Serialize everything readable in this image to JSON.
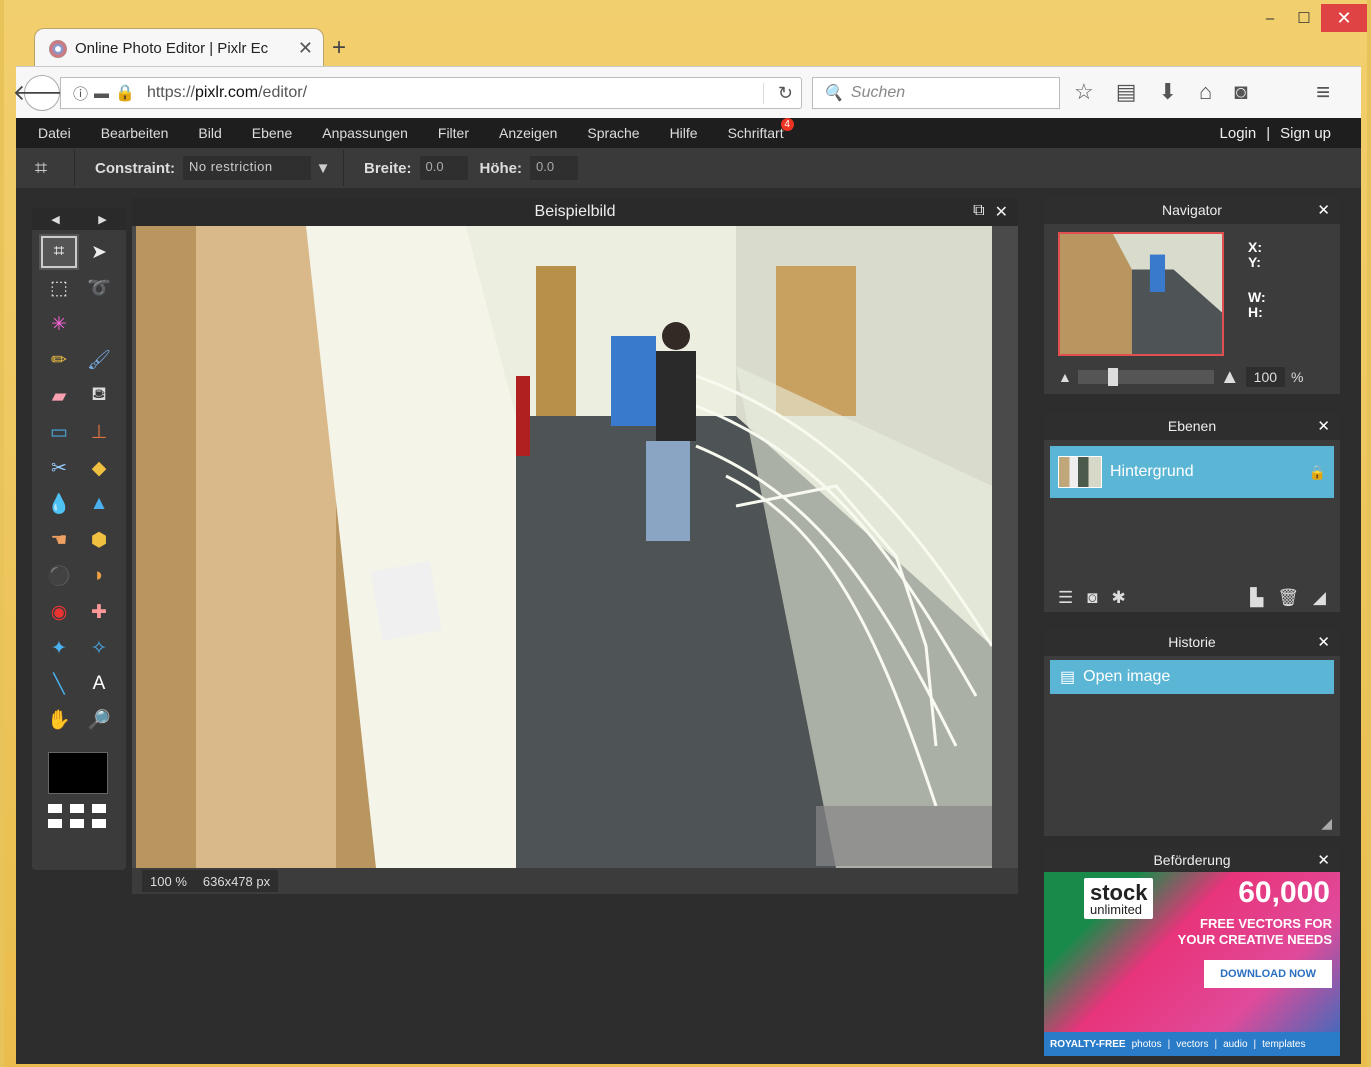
{
  "window": {
    "min": "–",
    "max": "☐",
    "close": "✕"
  },
  "tab": {
    "title": "Online Photo Editor | Pixlr Ec",
    "close": "✕",
    "new_tab": "+"
  },
  "navbar": {
    "back": "🡐",
    "info": "ⓘ",
    "url_prefix": "https://",
    "url_domain": "pixlr.com",
    "url_path": "/editor/",
    "reload": "↻",
    "search_placeholder": "Suchen",
    "search_icon": "🔍"
  },
  "toolbar_icons": [
    "☆",
    "▤",
    "⬇",
    "⌂",
    "◙"
  ],
  "menu_icon": "≡",
  "app": {
    "menu": [
      "Datei",
      "Bearbeiten",
      "Bild",
      "Ebene",
      "Anpassungen",
      "Filter",
      "Anzeigen",
      "Sprache",
      "Hilfe",
      "Schriftart"
    ],
    "font_badge": "4",
    "login": "Login",
    "separator": "|",
    "signup": "Sign up",
    "options": {
      "constraint_label": "Constraint:",
      "constraint_value": "No restriction",
      "width_label": "Breite:",
      "width_value": "0.0",
      "height_label": "Höhe:",
      "height_value": "0.0"
    },
    "toolbox": {
      "left_arrow": "◀",
      "right_arrow": "▶",
      "tools": [
        {
          "icon": "crop-icon",
          "glyph": "⌗"
        },
        {
          "icon": "move-icon",
          "glyph": "➤"
        },
        {
          "icon": "marquee-icon",
          "glyph": "⬚"
        },
        {
          "icon": "lasso-icon",
          "glyph": "➰"
        },
        {
          "icon": "wand-icon",
          "glyph": "✳"
        },
        {
          "icon": "blank",
          "glyph": ""
        },
        {
          "icon": "pencil-icon",
          "glyph": "✏"
        },
        {
          "icon": "brush-icon",
          "glyph": "🖌"
        },
        {
          "icon": "eraser-icon",
          "glyph": "▰"
        },
        {
          "icon": "bucket-icon",
          "glyph": "⛾"
        },
        {
          "icon": "gradient-icon",
          "glyph": "▭"
        },
        {
          "icon": "stamp-icon",
          "glyph": "⊥"
        },
        {
          "icon": "color-replace-icon",
          "glyph": "✂"
        },
        {
          "icon": "drawing-icon",
          "glyph": "◆"
        },
        {
          "icon": "blur-icon",
          "glyph": "💧"
        },
        {
          "icon": "sharpen-icon",
          "glyph": "▲"
        },
        {
          "icon": "smudge-icon",
          "glyph": "☚"
        },
        {
          "icon": "sponge-icon",
          "glyph": "⬢"
        },
        {
          "icon": "burn-icon",
          "glyph": "⚫"
        },
        {
          "icon": "dodge-icon",
          "glyph": "◗"
        },
        {
          "icon": "redeye-icon",
          "glyph": "◉"
        },
        {
          "icon": "spot-heal-icon",
          "glyph": "✚"
        },
        {
          "icon": "bloat-icon",
          "glyph": "✦"
        },
        {
          "icon": "pinch-icon",
          "glyph": "✧"
        },
        {
          "icon": "color-picker-icon",
          "glyph": "╲"
        },
        {
          "icon": "type-icon",
          "glyph": "A"
        },
        {
          "icon": "hand-icon",
          "glyph": "✋"
        },
        {
          "icon": "zoom-icon",
          "glyph": "🔎"
        }
      ]
    },
    "doc": {
      "title": "Beispielbild",
      "restore": "⧉",
      "close": "✕",
      "zoom": "100",
      "zoom_unit": "%",
      "size": "636x478 px"
    },
    "navigator": {
      "title": "Navigator",
      "close": "✕",
      "x": "X:",
      "y": "Y:",
      "w": "W:",
      "h": "H:",
      "zoom": "100",
      "unit": "%"
    },
    "layers": {
      "title": "Ebenen",
      "close": "✕",
      "layer_name": "Hintergrund",
      "lock": "🔒"
    },
    "history": {
      "title": "Historie",
      "close": "✕",
      "item": "Open image"
    },
    "promo": {
      "title": "Beförderung",
      "close": "✕",
      "brand": "stock",
      "brand_sub": "unlimited",
      "headline": "60,000",
      "sub1": "FREE VECTORS FOR",
      "sub2": "YOUR CREATIVE NEEDS",
      "cta": "DOWNLOAD NOW",
      "footer": [
        "ROYALTY-FREE",
        "photos",
        "|",
        "vectors",
        "|",
        "audio",
        "|",
        "templates"
      ]
    }
  }
}
